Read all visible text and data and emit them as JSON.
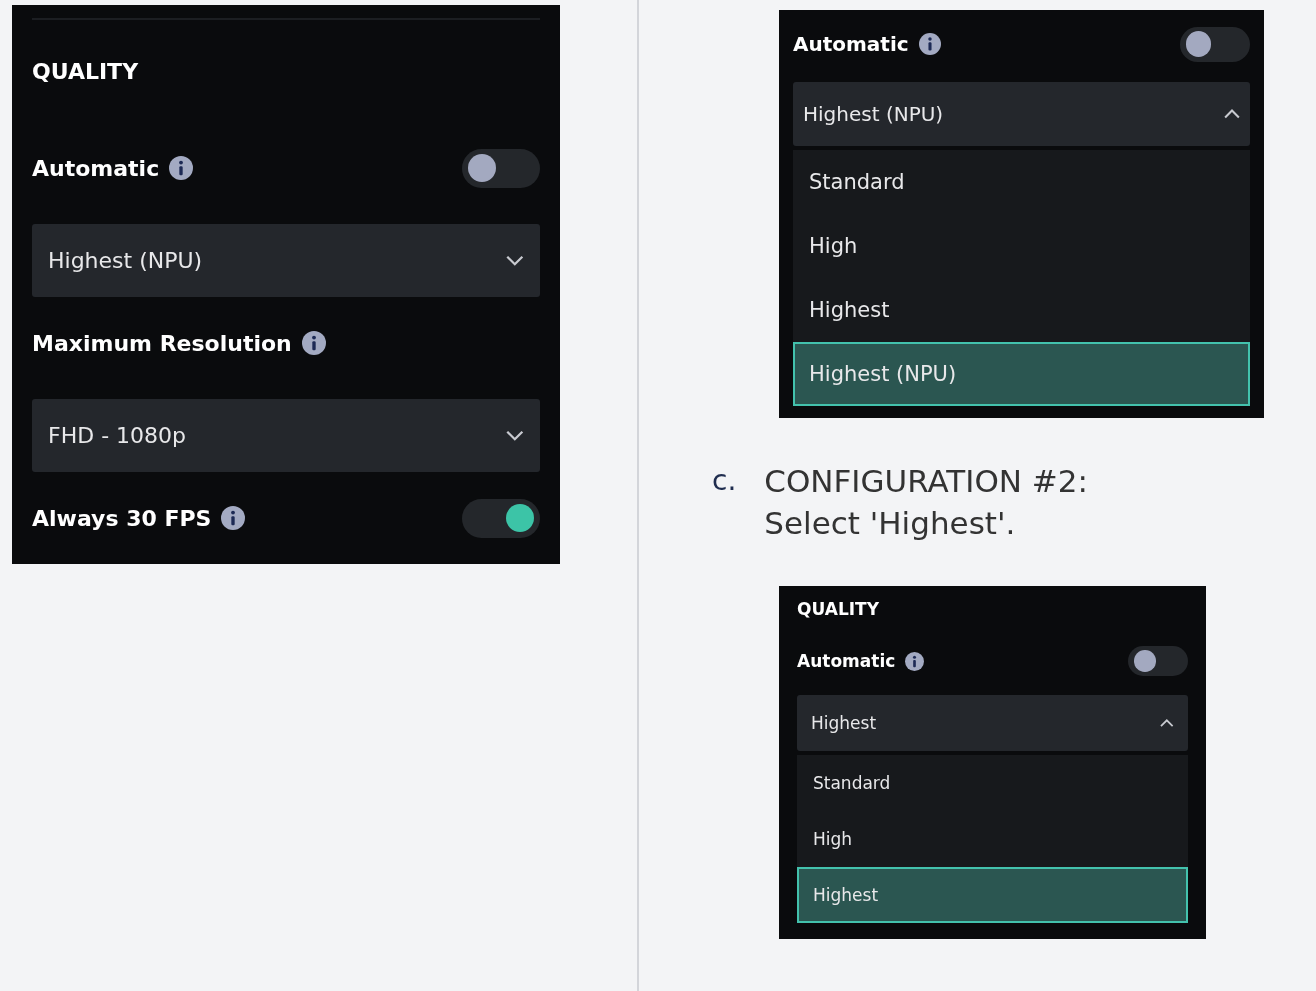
{
  "left_panel": {
    "section_title": "QUALITY",
    "rows": [
      {
        "kind": "toggle",
        "label": "Automatic",
        "on": false
      },
      {
        "kind": "select",
        "value": "Highest (NPU)",
        "expanded": false
      },
      {
        "kind": "heading",
        "label": "Maximum Resolution"
      },
      {
        "kind": "select",
        "value": "FHD - 1080p",
        "expanded": false
      },
      {
        "kind": "toggle",
        "label": "Always 30 FPS",
        "on": true
      }
    ]
  },
  "right_panel_top": {
    "rows": [
      {
        "kind": "toggle",
        "label": "Automatic",
        "on": false
      },
      {
        "kind": "select",
        "value": "Highest (NPU)",
        "expanded": true,
        "options": [
          {
            "label": "Standard",
            "selected": false
          },
          {
            "label": "High",
            "selected": false
          },
          {
            "label": "Highest",
            "selected": false
          },
          {
            "label": "Highest (NPU)",
            "selected": true
          }
        ]
      }
    ]
  },
  "step": {
    "marker": "c.",
    "text": "CONFIGURATION #2: Select 'Highest'."
  },
  "right_panel_bottom": {
    "section_title": "QUALITY",
    "rows": [
      {
        "kind": "toggle",
        "label": "Automatic",
        "on": false
      },
      {
        "kind": "select",
        "value": "Highest",
        "expanded": true,
        "options": [
          {
            "label": "Standard",
            "selected": false
          },
          {
            "label": "High",
            "selected": false
          },
          {
            "label": "Highest",
            "selected": true
          }
        ]
      }
    ]
  }
}
